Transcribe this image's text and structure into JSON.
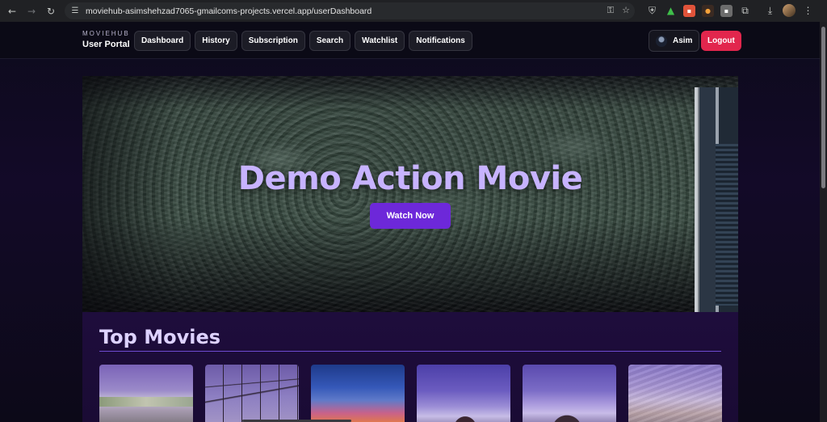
{
  "browser": {
    "url": "moviehub-asimshehzad7065-gmailcoms-projects.vercel.app/userDashboard",
    "icons": {
      "back": "arrow-left-icon",
      "forward": "arrow-right-icon",
      "reload": "reload-icon",
      "site_settings": "tune-icon",
      "password": "key-icon",
      "bookmark": "star-icon"
    }
  },
  "header": {
    "brand_small": "MOVIEHUB",
    "brand_title": "User Portal",
    "nav": [
      {
        "label": "Dashboard"
      },
      {
        "label": "History"
      },
      {
        "label": "Subscription"
      },
      {
        "label": "Search"
      },
      {
        "label": "Watchlist"
      },
      {
        "label": "Notifications"
      }
    ],
    "user_name": "Asim",
    "logout_label": "Logout"
  },
  "hero": {
    "title": "Demo Action Movie",
    "button_label": "Watch Now"
  },
  "top_movies": {
    "title": "Top Movies",
    "cards": 6
  },
  "colors": {
    "accent_purple": "#6d28d9",
    "title_lavender": "#c7b3ff",
    "logout_red": "#e2264d"
  }
}
